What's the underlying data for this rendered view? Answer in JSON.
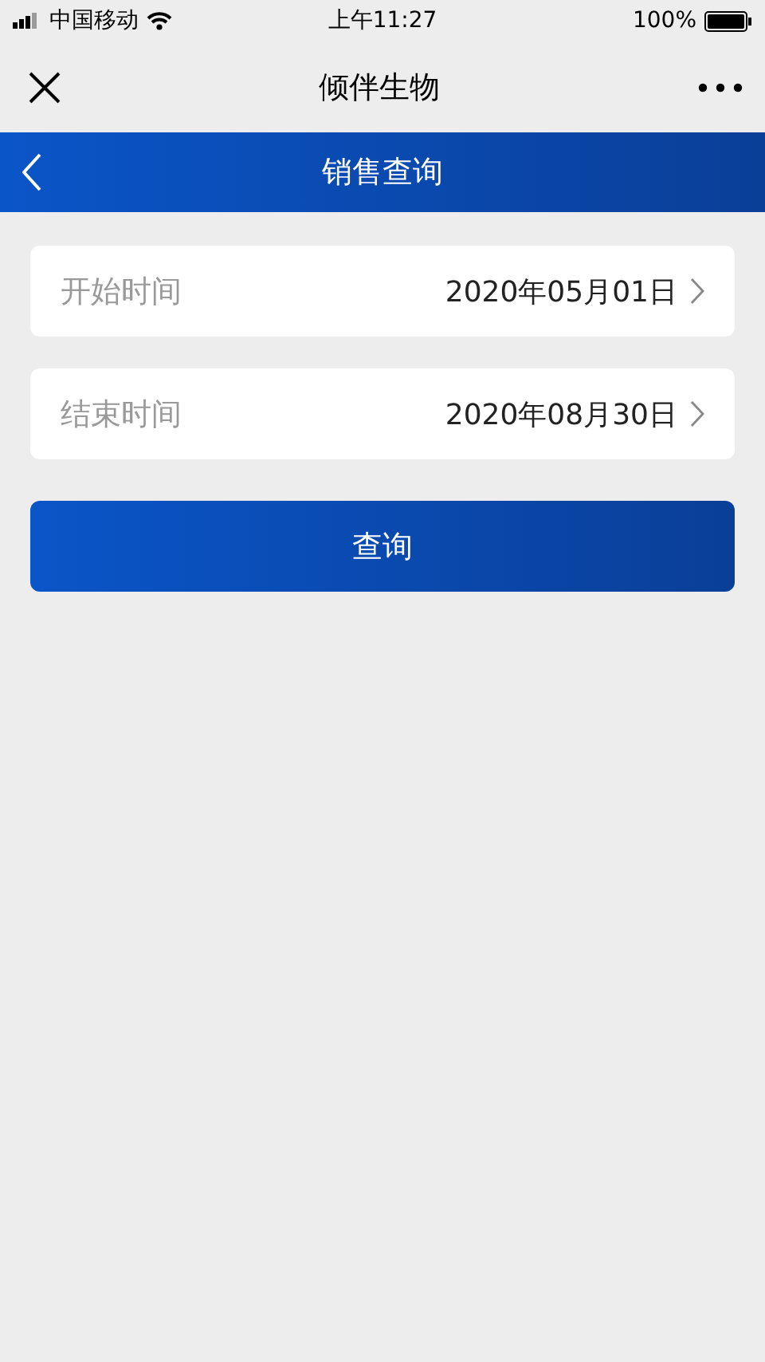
{
  "status_bar": {
    "carrier": "中国移动",
    "time": "上午11:27",
    "battery": "100%"
  },
  "nav_bar": {
    "title": "倾伴生物"
  },
  "header": {
    "title": "销售查询"
  },
  "fields": [
    {
      "label": "开始时间",
      "value": "2020年05月01日"
    },
    {
      "label": "结束时间",
      "value": "2020年08月30日"
    }
  ],
  "button": {
    "label": "查询"
  }
}
